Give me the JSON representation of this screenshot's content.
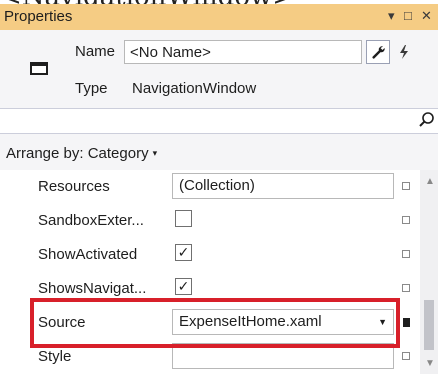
{
  "top_text": "<NavigationWindow>",
  "panel": {
    "title": "Properties",
    "pin_glyph": "▾",
    "maximize_glyph": "□",
    "close_glyph": "✕"
  },
  "header": {
    "name_label": "Name",
    "name_value": "<No Name>",
    "type_label": "Type",
    "type_value": "NavigationWindow",
    "properties_button_icon": "wrench-icon",
    "events_button_icon": "lightning-bolt-icon"
  },
  "search": {
    "placeholder": "",
    "value": "",
    "icon": "search-icon"
  },
  "arrange": {
    "label": "Arrange by: Category",
    "caret": "▾"
  },
  "properties": [
    {
      "name": "Resources",
      "kind": "text",
      "value": "(Collection)",
      "marker": "default"
    },
    {
      "name": "SandboxExter...",
      "kind": "checkbox",
      "value": "",
      "marker": "default"
    },
    {
      "name": "ShowActivated",
      "kind": "checkbox",
      "value": "✓",
      "marker": "default"
    },
    {
      "name": "ShowsNavigat...",
      "kind": "checkbox",
      "value": "✓",
      "marker": "default"
    },
    {
      "name": "Source",
      "kind": "dropdown",
      "value": "ExpenseItHome.xaml",
      "dropdown_glyph": "▼",
      "marker": "set"
    },
    {
      "name": "Style",
      "kind": "text",
      "value": "",
      "marker": "default"
    }
  ],
  "colors": {
    "title_bar": "#f5cc84",
    "highlight_border": "#d8202a",
    "header_background": "#f5f5f7"
  }
}
